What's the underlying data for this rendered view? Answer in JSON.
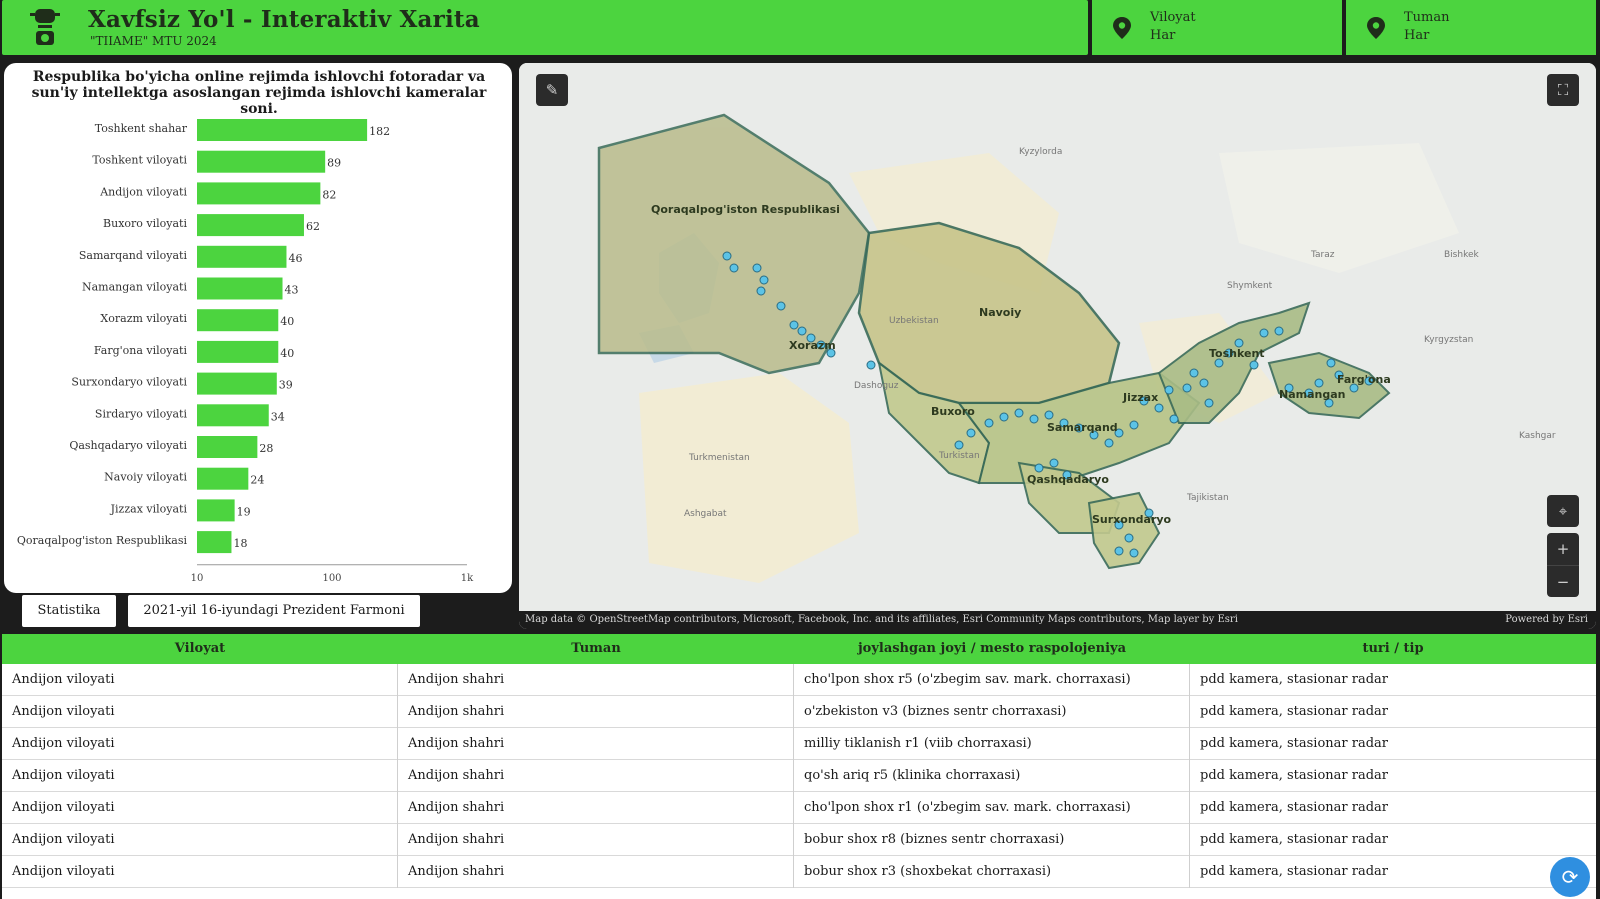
{
  "header": {
    "title": "Xavfsiz Yo'l - Interaktiv Xarita",
    "subtitle": "\"TIIAME\" MTU 2024",
    "filters": [
      {
        "label": "Viloyat",
        "value": "Har"
      },
      {
        "label": "Tuman",
        "value": "Har"
      }
    ]
  },
  "chart_panel": {
    "title": "Respublika bo'yicha online rejimda ishlovchi fotoradar va sun'iy intellektga asoslangan rejimda ishlovchi  kameralar soni."
  },
  "chart_data": {
    "type": "bar",
    "orientation": "horizontal",
    "x_scale": "log",
    "xlim": [
      10,
      1000
    ],
    "x_ticks": [
      "10",
      "100",
      "1k"
    ],
    "bar_color": "#4cd43f",
    "categories": [
      "Toshkent shahar",
      "Toshkent viloyati",
      "Andijon viloyati",
      "Buxoro viloyati",
      "Samarqand viloyati",
      "Namangan viloyati",
      "Xorazm viloyati",
      "Farg'ona viloyati",
      "Surxondaryo viloyati",
      "Sirdaryo viloyati",
      "Qashqadaryo viloyati",
      "Navoiy viloyati",
      "Jizzax viloyati",
      "Qoraqalpog'iston Respublikasi"
    ],
    "values": [
      182,
      89,
      82,
      62,
      46,
      43,
      40,
      40,
      39,
      34,
      28,
      24,
      19,
      18
    ]
  },
  "tabs": [
    {
      "label": "Statistika"
    },
    {
      "label": "2021-yil 16-iyundagi Prezident Farmoni"
    }
  ],
  "map": {
    "labels": {
      "qoraqalpogiston": "Qoraqalpog'iston Respublikasi",
      "navoiy": "Navoiy",
      "xorazm": "Xorazm",
      "buxoro": "Buxoro",
      "samarqand": "Samarqand",
      "jizzax": "Jizzax",
      "toshkent": "Toshkent",
      "fargona": "Farg'ona",
      "namangan": "Namangan",
      "qashqadaryo": "Qashqadaryo",
      "surxondaryo": "Surxondaryo",
      "uzbekistan": "Uzbekistan",
      "turkmenistan": "Turkmenistan",
      "tajikistan": "Tajikistan",
      "kyrgyzstan": "Kyrgyzstan",
      "shymkent": "Shymkent",
      "taraz": "Taraz",
      "bishkek": "Bishkek",
      "kashgar": "Kashgar",
      "ashgabat": "Ashgabat",
      "kyzylorda": "Kyzylorda",
      "dashoguz": "Dashoguz",
      "turkistan": "Turkistan"
    },
    "attribution": "Map data © OpenStreetMap contributors, Microsoft, Facebook, Inc. and its affiliates, Esri Community Maps contributors, Map layer by Esri",
    "powered_by": "Powered by Esri",
    "zoom_in": "+",
    "zoom_out": "−"
  },
  "table": {
    "columns": [
      "Viloyat",
      "Tuman",
      "joylashgan joyi / mesto raspolojeniya",
      "turi / tip"
    ],
    "rows": [
      [
        "Andijon viloyati",
        "Andijon shahri",
        "cho'lpon shox r5 (o'zbegim sav. mark. chorraxasi)",
        "pdd kamera, stasionar radar"
      ],
      [
        "Andijon viloyati",
        "Andijon shahri",
        "o'zbekiston v3 (biznes sentr chorraxasi)",
        "pdd kamera, stasionar radar"
      ],
      [
        "Andijon viloyati",
        "Andijon shahri",
        "milliy tiklanish r1 (viib chorraxasi)",
        "pdd kamera, stasionar radar"
      ],
      [
        "Andijon viloyati",
        "Andijon shahri",
        "qo'sh ariq r5 (klinika chorraxasi)",
        "pdd kamera, stasionar radar"
      ],
      [
        "Andijon viloyati",
        "Andijon shahri",
        "cho'lpon shox r1 (o'zbegim sav. mark. chorraxasi)",
        "pdd kamera, stasionar radar"
      ],
      [
        "Andijon viloyati",
        "Andijon shahri",
        "bobur shox r8 (biznes sentr chorraxasi)",
        "pdd kamera, stasionar radar"
      ],
      [
        "Andijon viloyati",
        "Andijon shahri",
        "bobur shox r3 (shoxbekat chorraxasi)",
        "pdd kamera, stasionar radar"
      ]
    ]
  }
}
